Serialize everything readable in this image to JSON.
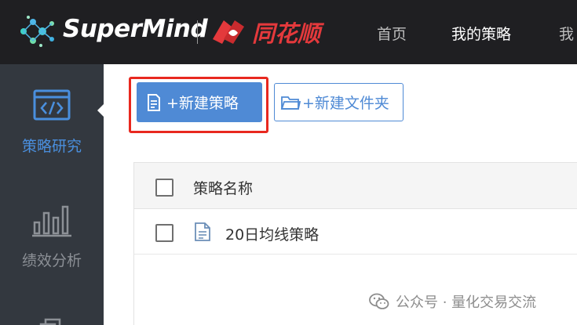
{
  "header": {
    "brand_name": "SuperMind",
    "partner_name": "同花顺",
    "nav": [
      {
        "label": "首页",
        "active": false
      },
      {
        "label": "我的策略",
        "active": true
      },
      {
        "label": "我",
        "active": false
      }
    ]
  },
  "sidebar": {
    "items": [
      {
        "label": "策略研究",
        "icon": "code-window-icon",
        "active": true
      },
      {
        "label": "绩效分析",
        "icon": "bar-chart-icon",
        "active": false
      },
      {
        "label": "",
        "icon": "stack-icon",
        "active": false
      }
    ]
  },
  "toolbar": {
    "new_strategy_label": "+新建策略",
    "new_folder_label": "+新建文件夹"
  },
  "table": {
    "column_header": "策略名称",
    "rows": [
      {
        "name": "20日均线策略"
      }
    ]
  },
  "watermark": "公众号 · 量化交易交流",
  "colors": {
    "accent": "#4f8ad5",
    "topbar": "#1f1f22",
    "sidebar": "#33383f",
    "highlight": "#e8281f",
    "brand_red": "#e4393c"
  }
}
